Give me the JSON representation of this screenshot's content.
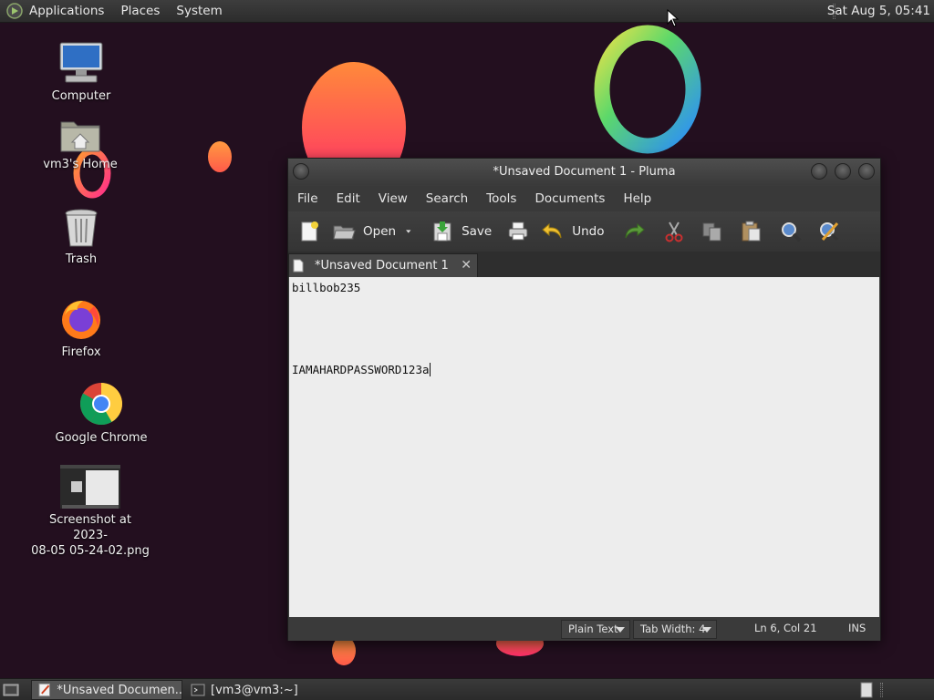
{
  "top_panel": {
    "menus": [
      "Applications",
      "Places",
      "System"
    ],
    "clock": "Sat Aug  5, 05:41"
  },
  "desktop_icons": [
    {
      "label": "Computer",
      "icon": "computer-icon"
    },
    {
      "label": "vm3's Home",
      "icon": "home-folder-icon"
    },
    {
      "label": "Trash",
      "icon": "trash-icon"
    },
    {
      "label": "Firefox",
      "icon": "firefox-icon"
    },
    {
      "label": "Google Chrome",
      "icon": "chrome-icon"
    },
    {
      "label_line1": "Screenshot at 2023-",
      "label_line2": "08-05 05-24-02.png",
      "icon": "image-thumbnail-icon"
    }
  ],
  "window": {
    "title": "*Unsaved Document 1 - Pluma",
    "menu": [
      "File",
      "Edit",
      "View",
      "Search",
      "Tools",
      "Documents",
      "Help"
    ],
    "toolbar": {
      "open_label": "Open",
      "save_label": "Save",
      "undo_label": "Undo"
    },
    "tab": {
      "label": "*Unsaved Document 1",
      "close": "✕"
    },
    "editor_lines": [
      "billbob235",
      "",
      "",
      "",
      "",
      "IAMAHARDPASSWORD123a"
    ],
    "status": {
      "language": "Plain Text",
      "tab_width": "Tab Width:  4",
      "position": "Ln 6, Col 21",
      "mode": "INS"
    }
  },
  "taskbar": {
    "tasks": [
      {
        "label": "*Unsaved Documen...",
        "icon": "text-editor-icon",
        "active": true
      },
      {
        "label": "[vm3@vm3:~]",
        "icon": "terminal-icon",
        "active": false
      }
    ]
  },
  "colors": {
    "desktop_bg": "#220f1f",
    "panel_bg": "#333333",
    "window_bg": "#3b3b3b",
    "editor_bg": "#ededed"
  }
}
